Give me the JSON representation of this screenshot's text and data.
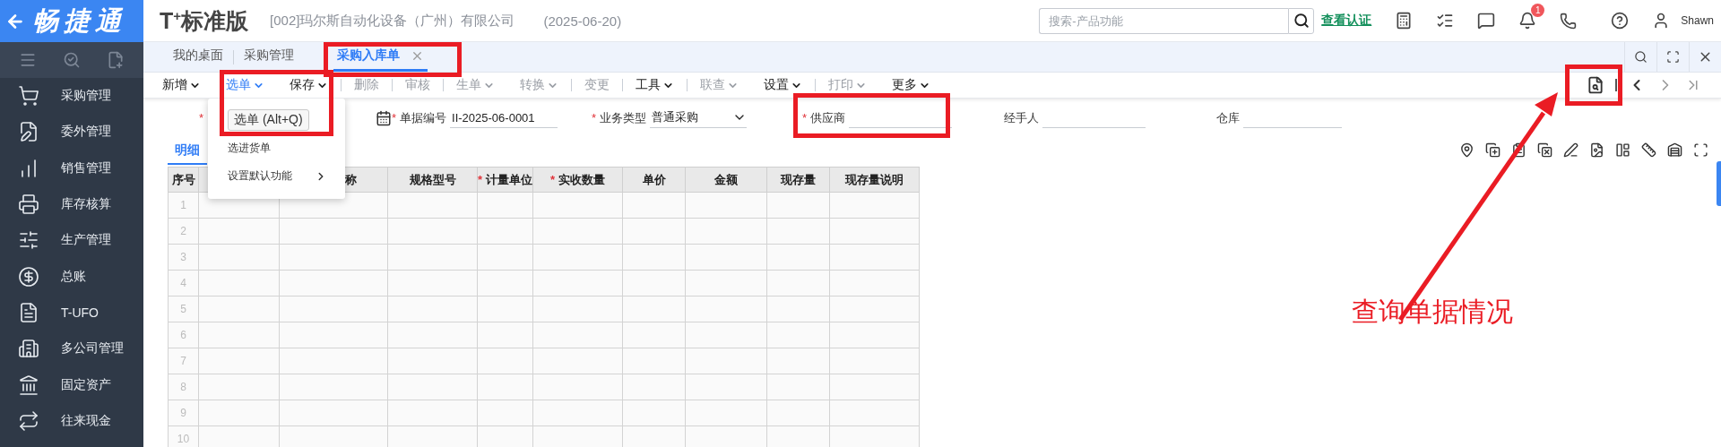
{
  "sidebar": {
    "brand": "畅捷通",
    "items": [
      {
        "label": "采购管理"
      },
      {
        "label": "委外管理"
      },
      {
        "label": "销售管理"
      },
      {
        "label": "库存核算"
      },
      {
        "label": "生产管理"
      },
      {
        "label": "总账"
      },
      {
        "label": "T-UFO"
      },
      {
        "label": "多公司管理"
      },
      {
        "label": "固定资产"
      },
      {
        "label": "往来现金"
      }
    ]
  },
  "header": {
    "product": "T$^{+}$标准版",
    "company": "[002]玛尔斯自动化设备（广州）有限公司",
    "date": "(2025-06-20)",
    "search": {
      "placeholder": "搜索-产品功能"
    },
    "verify_link": "查看认证",
    "notification_count": "1",
    "user": "Shawn"
  },
  "tabs": [
    {
      "label": "我的桌面",
      "selected": false,
      "closable": false
    },
    {
      "label": "采购管理",
      "selected": false,
      "closable": false
    },
    {
      "label": "采购入库单",
      "selected": true,
      "closable": true
    }
  ],
  "toolbar": [
    {
      "kind": "button",
      "label": "新增",
      "caret": true,
      "disabled": false,
      "selected": false
    },
    {
      "kind": "button",
      "label": "选单",
      "caret": true,
      "disabled": false,
      "selected": true
    },
    {
      "kind": "button",
      "label": "保存",
      "caret": true,
      "disabled": false,
      "selected": false
    },
    {
      "kind": "separator"
    },
    {
      "kind": "button",
      "label": "删除",
      "caret": false,
      "disabled": true,
      "selected": false
    },
    {
      "kind": "separator"
    },
    {
      "kind": "button",
      "label": "审核",
      "caret": false,
      "disabled": true,
      "selected": false
    },
    {
      "kind": "separator"
    },
    {
      "kind": "button",
      "label": "生单",
      "caret": true,
      "disabled": true,
      "selected": false
    },
    {
      "kind": "button",
      "label": "转换",
      "caret": true,
      "disabled": true,
      "selected": false
    },
    {
      "kind": "separator"
    },
    {
      "kind": "button",
      "label": "变更",
      "caret": false,
      "disabled": true,
      "selected": false
    },
    {
      "kind": "separator"
    },
    {
      "kind": "button",
      "label": "工具",
      "caret": true,
      "disabled": false,
      "selected": false
    },
    {
      "kind": "separator"
    },
    {
      "kind": "button",
      "label": "联查",
      "caret": true,
      "disabled": true,
      "selected": false
    },
    {
      "kind": "button",
      "label": "设置",
      "caret": true,
      "disabled": false,
      "selected": false
    },
    {
      "kind": "separator"
    },
    {
      "kind": "button",
      "label": "打印",
      "caret": true,
      "disabled": true,
      "selected": false
    },
    {
      "kind": "button",
      "label": "更多",
      "caret": true,
      "disabled": false,
      "selected": false
    }
  ],
  "menu": {
    "tooltip": "选单 (Alt+Q)",
    "items": [
      {
        "label": "选进货单",
        "submenu": false
      },
      {
        "label": "设置默认功能",
        "submenu": true
      }
    ]
  },
  "form": {
    "fields": [
      {
        "kind": "date",
        "mark": "*"
      },
      {
        "kind": "text",
        "mark": "*",
        "label": "单据编号",
        "value": "II-2025-06-0001"
      },
      {
        "kind": "select",
        "mark": "*",
        "label": "业务类型",
        "value": "普通采购"
      },
      {
        "kind": "text",
        "mark": "*",
        "label": "供应商"
      },
      {
        "kind": "text",
        "label": "经手人"
      },
      {
        "kind": "text",
        "label": "仓库"
      }
    ]
  },
  "detail_tabs": [
    {
      "label": "明细",
      "selected": true
    }
  ],
  "table": {
    "columns": [
      {
        "label": "序号"
      },
      {},
      {
        "label": "称"
      },
      {
        "label": "规格型号"
      },
      {
        "mark": "*",
        "label": "计量单位"
      },
      {
        "mark": "*",
        "label": "实收数量"
      },
      {
        "label": "单价"
      },
      {
        "label": "金额"
      },
      {
        "label": "现存量"
      },
      {
        "label": "现存量说明"
      }
    ],
    "rows": [
      "1",
      "2",
      "3",
      "4",
      "5",
      "6",
      "7",
      "8",
      "9",
      "10"
    ]
  },
  "annotations": [
    {
      "kind": "box"
    },
    {
      "kind": "box"
    },
    {
      "kind": "box"
    },
    {
      "kind": "box"
    },
    {
      "kind": "arrow"
    },
    {
      "kind": "note",
      "text": "查询单据情况"
    }
  ]
}
